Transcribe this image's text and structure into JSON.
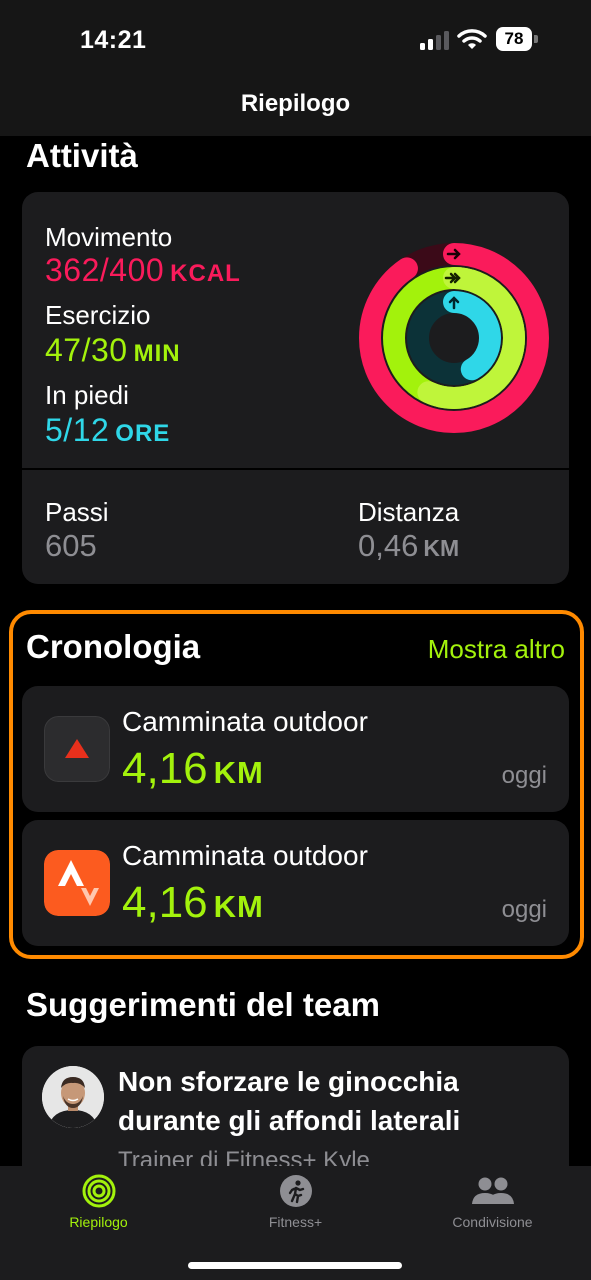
{
  "status_bar": {
    "time": "14:21",
    "battery": "78"
  },
  "nav": {
    "title": "Riepilogo"
  },
  "activity": {
    "section_title": "Attività",
    "move": {
      "label": "Movimento",
      "value": "362/400",
      "unit": "KCAL",
      "progress": 0.905
    },
    "exercise": {
      "label": "Esercizio",
      "value": "47/30",
      "unit": "MIN",
      "progress": 1.57
    },
    "stand": {
      "label": "In piedi",
      "value": "5/12",
      "unit": "ORE",
      "progress": 0.417
    },
    "steps": {
      "label": "Passi",
      "value": "605"
    },
    "distance": {
      "label": "Distanza",
      "value": "0,46",
      "unit": "KM"
    }
  },
  "history": {
    "section_title": "Cronologia",
    "show_more": "Mostra altro",
    "items": [
      {
        "name": "Camminata outdoor",
        "value": "4,16",
        "unit": "KM",
        "date": "oggi",
        "icon": "triangle-app-icon"
      },
      {
        "name": "Camminata outdoor",
        "value": "4,16",
        "unit": "KM",
        "date": "oggi",
        "icon": "strava-app-icon"
      }
    ]
  },
  "tips": {
    "section_title": "Suggerimenti del team",
    "card": {
      "title": "Non sforzare le ginocchia durante gli affondi laterali",
      "subtitle": "Trainer di Fitness+ Kyle"
    }
  },
  "tab_bar": {
    "tabs": [
      {
        "label": "Riepilogo",
        "icon": "activity-rings-icon",
        "active": true
      },
      {
        "label": "Fitness+",
        "icon": "runner-icon",
        "active": false
      },
      {
        "label": "Condivisione",
        "icon": "people-icon",
        "active": false
      }
    ]
  },
  "colors": {
    "move": "#fa1b5b",
    "exercise": "#a3f20c",
    "stand": "#2fd7e8",
    "highlight": "#ff8a00"
  }
}
